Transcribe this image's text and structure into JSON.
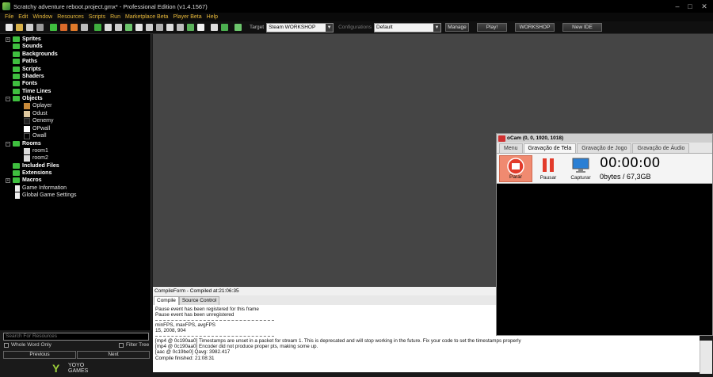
{
  "window": {
    "title": "Scratchy adventure reboot.project.gmx*  -  Professional Edition (v1.4.1567)",
    "controls": [
      "–",
      "□",
      "✕"
    ]
  },
  "menu": [
    "File",
    "Edit",
    "Window",
    "Resources",
    "Scripts",
    "Run",
    "Marketplace Beta",
    "Player Beta",
    "Help"
  ],
  "toolbar": {
    "target_label": "Target",
    "target_value": "Steam WORKSHOP",
    "config_label": "Configurations",
    "config_value": "Default",
    "manage_label": "Manage",
    "play_label": "Play!",
    "workshop_label": "WORKSHOP",
    "new_ide_label": "New IDE"
  },
  "tree": {
    "sprites": "Sprites",
    "sounds": "Sounds",
    "backgrounds": "Backgrounds",
    "paths": "Paths",
    "scripts": "Scripts",
    "shaders": "Shaders",
    "fonts": "Fonts",
    "timelines": "Time Lines",
    "objects": "Objects",
    "obj1": "Oplayer",
    "obj2": "Odust",
    "obj3": "Oenemy",
    "obj4": "OPwall",
    "obj5": "Owall",
    "rooms": "Rooms",
    "room1": "room1",
    "room2": "room2",
    "included": "Included Files",
    "extensions": "Extensions",
    "macros": "Macros",
    "gameinfo": "Game Information",
    "settings": "Global Game Settings"
  },
  "search": {
    "placeholder": "Search For Resources",
    "whole_word": "Whole Word Only",
    "filter_tree": "Filter Tree",
    "previous": "Previous",
    "next": "Next"
  },
  "logo": {
    "mark": "Y",
    "line1": "YOYO",
    "line2": "GAMES"
  },
  "compile": {
    "header": "CompileForm - Compiled at:21:06:35",
    "tab_compile": "Compile",
    "tab_source": "Source Control",
    "lines_a": [
      "Pause event has been registered for this frame",
      "Pause event has been unregistered"
    ],
    "lines_b": [
      "minFPS, maxFPS, avgFPS",
      "15, 2008, 904"
    ],
    "lines_c": [
      "[mp4 @ 0c190aa0] Timestamps are unset in a packet for stream 1. This is deprecated and will stop working in the future. Fix your code to set the timestamps properly",
      "[mp4 @ 0c190aa0] Encoder did not produce proper pts, making some up.",
      "[aac @ 0c19be0] Qavg: 3982.417",
      "Compile finished: 21:08:31"
    ]
  },
  "ocam": {
    "title": "oCam (0, 0, 1920, 1018)",
    "tabs": [
      "Menu",
      "Gravação de Tela",
      "Gravação de Jogo",
      "Gravação de Áudio"
    ],
    "stop": "Parar",
    "pause": "Pausar",
    "capture": "Capturar",
    "timer": "00:00:00",
    "size": "0bytes / 67,3GB"
  }
}
